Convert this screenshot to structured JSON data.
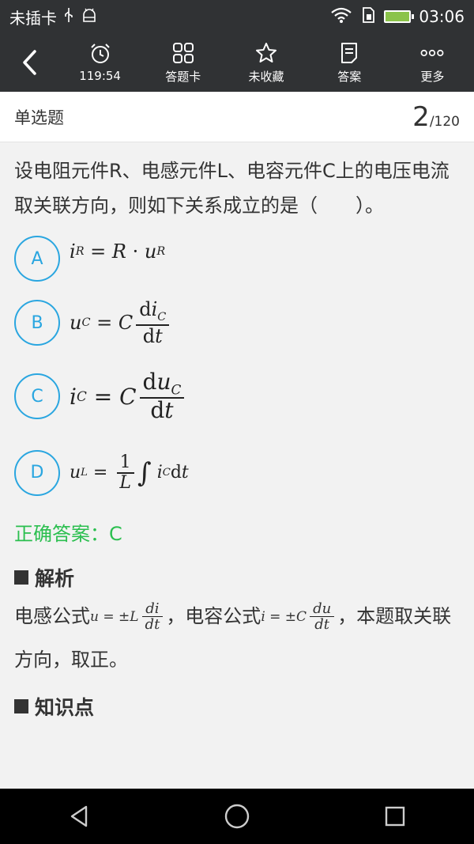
{
  "status_bar": {
    "carrier": "未插卡",
    "time": "03:06",
    "icons": [
      "usb-icon",
      "android-debug-icon",
      "wifi-icon",
      "sim-icon",
      "battery-charging-icon"
    ]
  },
  "toolbar": {
    "back_icon": "back-arrow-icon",
    "items": [
      {
        "icon": "alarm-clock-icon",
        "label": "119:54"
      },
      {
        "icon": "grid-icon",
        "label": "答题卡"
      },
      {
        "icon": "star-outline-icon",
        "label": "未收藏"
      },
      {
        "icon": "document-icon",
        "label": "答案"
      },
      {
        "icon": "more-dots-icon",
        "label": "更多"
      }
    ]
  },
  "question_header": {
    "type": "单选题",
    "current": "2",
    "total": "/120"
  },
  "question": {
    "text": "设电阻元件R、电感元件L、电容元件C上的电压电流取关联方向，则如下关系成立的是（　　）。",
    "options": [
      {
        "letter": "A",
        "formula": "i_R = R · u_R"
      },
      {
        "letter": "B",
        "formula": "u_C = C di_C/dt"
      },
      {
        "letter": "C",
        "formula": "i_C = C du_C/dt"
      },
      {
        "letter": "D",
        "formula": "u_L = (1/L) ∫ i_C dt"
      }
    ]
  },
  "answer": {
    "label": "正确答案：C"
  },
  "analysis": {
    "heading": "解析",
    "part1": "电感公式",
    "part2": "，电容公式",
    "part3": "，本题取关联方向，取正。"
  },
  "knowledge": {
    "heading": "知识点"
  },
  "navbar": {
    "icons": [
      "back-triangle-icon",
      "home-circle-icon",
      "recents-square-icon"
    ]
  },
  "colors": {
    "accent": "#2aa6e0",
    "correct": "#2bbf4f",
    "toolbar_bg": "#303234"
  }
}
